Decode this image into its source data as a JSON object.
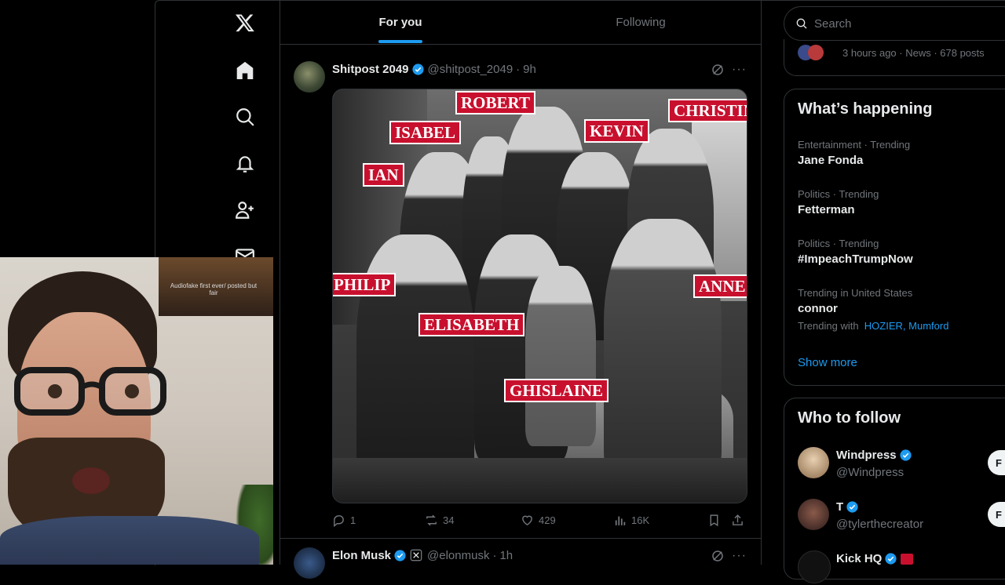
{
  "nav": {
    "items": [
      {
        "icon": "x-logo-icon"
      },
      {
        "icon": "home-icon"
      },
      {
        "icon": "search-icon"
      },
      {
        "icon": "bell-icon"
      },
      {
        "icon": "add-person-icon"
      },
      {
        "icon": "mail-icon"
      }
    ]
  },
  "tabs": [
    {
      "label": "For you",
      "active": true
    },
    {
      "label": "Following",
      "active": false
    }
  ],
  "post": {
    "author_name": "Shitpost 2049",
    "handle": "@shitpost_2049",
    "dot": "·",
    "time": "9h",
    "more": "···",
    "image_labels": [
      "ROBERT",
      "CHRISTIN",
      "ISABEL",
      "KEVIN",
      "IAN",
      "PHILIP",
      "ANNE",
      "ELISABETH",
      "GHISLAINE"
    ],
    "stats": {
      "replies": "1",
      "reposts": "34",
      "likes": "429",
      "views": "16K"
    }
  },
  "post2": {
    "author_name": "Elon Musk",
    "handle": "@elonmusk",
    "dot": "·",
    "time": "1h",
    "more": "···"
  },
  "search": {
    "placeholder": "Search"
  },
  "news": {
    "meta": "3 hours ago · News · 678 posts"
  },
  "happening": {
    "title": "What’s happening",
    "trends": [
      {
        "category": "Entertainment · Trending",
        "name": "Jane Fonda"
      },
      {
        "category": "Politics · Trending",
        "name": "Fetterman"
      },
      {
        "category": "Politics · Trending",
        "name": "#ImpeachTrumpNow"
      },
      {
        "category": "Trending in United States",
        "name": "connor"
      }
    ],
    "trending_with_label": "Trending with",
    "trending_with_links": [
      "HOZIER",
      "Mumford"
    ],
    "show_more": "Show more"
  },
  "who_to_follow": {
    "title": "Who to follow",
    "accounts": [
      {
        "name": "Windpress",
        "handle": "@Windpress",
        "button": "F"
      },
      {
        "name": "T",
        "handle": "@tylerthecreator",
        "button": "F"
      },
      {
        "name": "Kick HQ",
        "handle": "",
        "button": ""
      }
    ]
  },
  "webcam": {
    "frame_text": "Audiofake first ever/ posted but fair"
  },
  "colors": {
    "accent": "#1d9bf0",
    "verified": "#1d9bf0",
    "tag_red": "#c8102e",
    "border": "#2f3336",
    "muted": "#71767b"
  }
}
